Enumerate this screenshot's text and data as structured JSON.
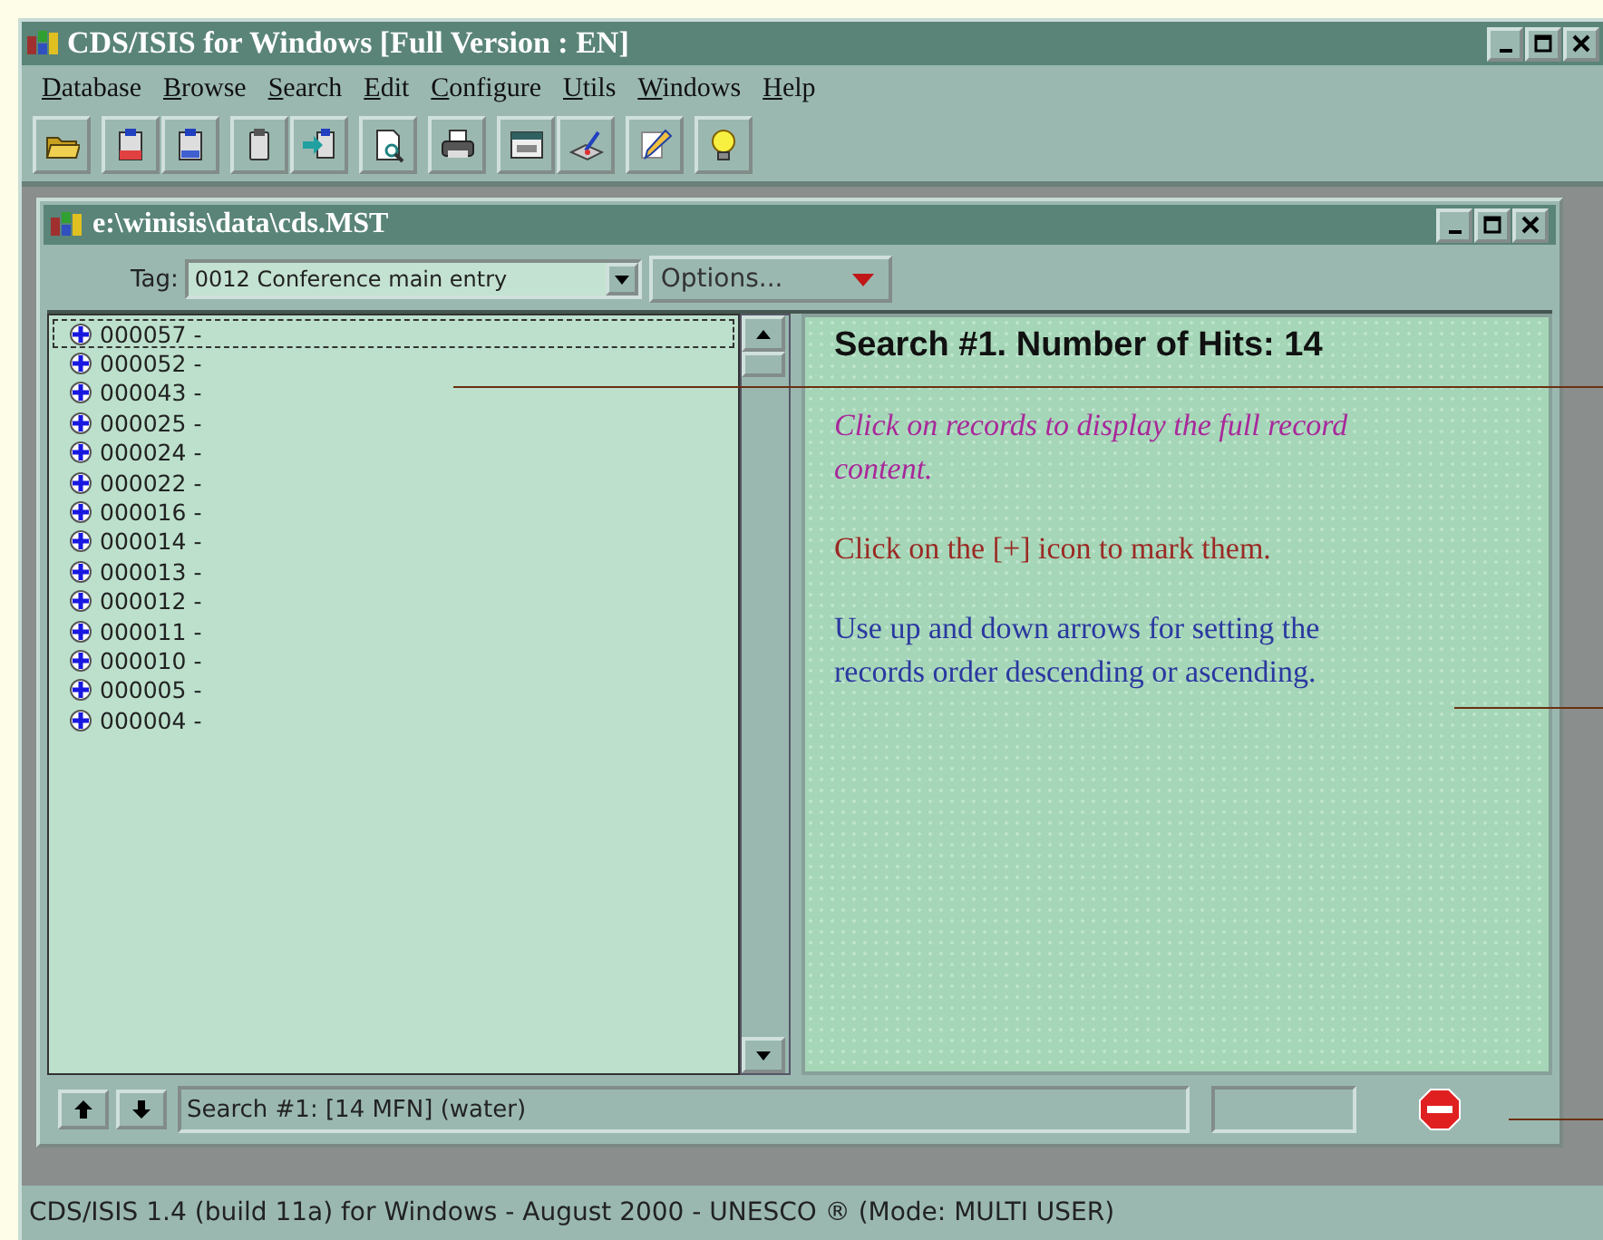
{
  "window": {
    "title": "CDS/ISIS for Windows [Full Version : EN]"
  },
  "menu": [
    "Database",
    "Browse",
    "Search",
    "Edit",
    "Configure",
    "Utils",
    "Windows",
    "Help"
  ],
  "child_window": {
    "title": "e:\\winisis\\data\\cds.MST",
    "tag": {
      "label": "Tag:",
      "value": "0012 Conference main entry"
    },
    "options": {
      "label": "Options..."
    },
    "records": [
      {
        "mfn": "000057 -",
        "selected": true
      },
      {
        "mfn": "000052 -",
        "selected": false
      },
      {
        "mfn": "000043 -",
        "selected": false
      },
      {
        "mfn": "000025 -",
        "selected": false
      },
      {
        "mfn": "000024 -",
        "selected": false
      },
      {
        "mfn": "000022 -",
        "selected": false
      },
      {
        "mfn": "000016 -",
        "selected": false
      },
      {
        "mfn": "000014 -",
        "selected": false
      },
      {
        "mfn": "000013 -",
        "selected": false
      },
      {
        "mfn": "000012 -",
        "selected": false
      },
      {
        "mfn": "000011 -",
        "selected": false
      },
      {
        "mfn": "000010 -",
        "selected": false
      },
      {
        "mfn": "000005 -",
        "selected": false
      },
      {
        "mfn": "000004 -",
        "selected": false
      }
    ],
    "messages": [
      {
        "kind": "heading",
        "text": "Search #1. Number of Hits: 14",
        "color": "#111111"
      },
      {
        "kind": "emphasis",
        "text": "Click on records to display the full record content.",
        "color": "#a8289a"
      },
      {
        "kind": "note",
        "text": "Click on the [+] icon to mark them.",
        "color": "#9a2a24"
      },
      {
        "kind": "note",
        "text": "Use up and down arrows for setting the records order descending or ascending.",
        "color": "#2a38a0"
      }
    ],
    "search_field": {
      "value": "Search #1: [14 MFN] (water)"
    }
  },
  "status_bar": "CDS/ISIS 1.4 (build 11a) for Windows - August 2000 - UNESCO ® (Mode: MULTI USER)"
}
